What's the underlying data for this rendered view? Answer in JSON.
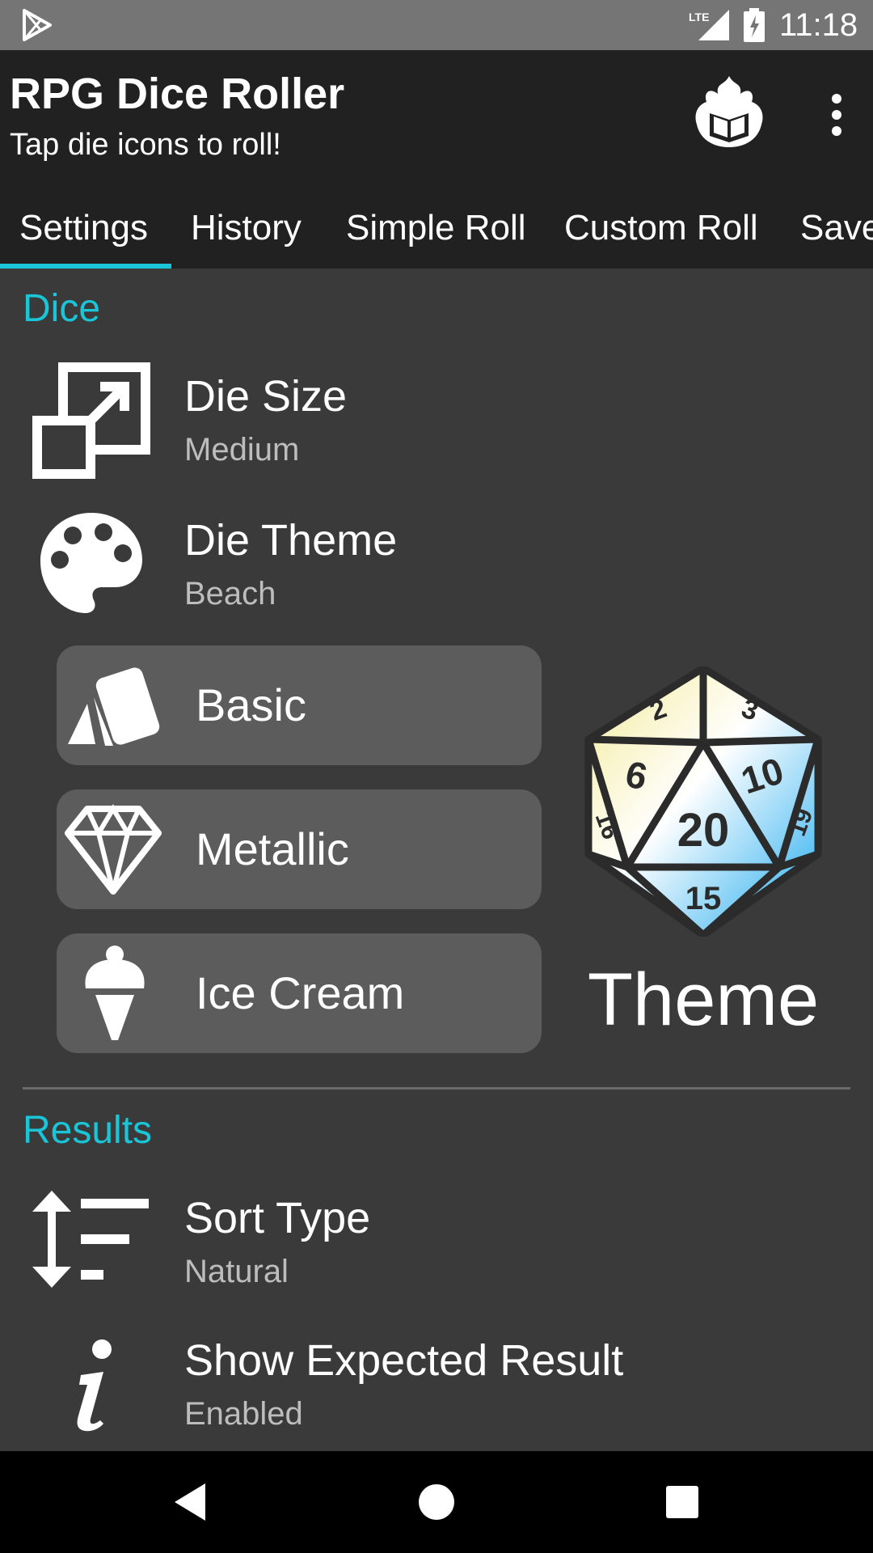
{
  "status_bar": {
    "time": "11:18",
    "network_label": "LTE",
    "icons": [
      "play-store-icon",
      "signal-icon",
      "battery-charging-icon"
    ]
  },
  "app_bar": {
    "title": "RPG Dice Roller",
    "subtitle": "Tap die icons to roll!",
    "icons": [
      "brand-flame-book-icon",
      "overflow-menu-icon"
    ]
  },
  "tabs": [
    {
      "label": "Settings",
      "selected": true
    },
    {
      "label": "History",
      "selected": false
    },
    {
      "label": "Simple Roll",
      "selected": false
    },
    {
      "label": "Custom Roll",
      "selected": false
    },
    {
      "label": "Save",
      "selected": false
    }
  ],
  "sections": {
    "dice": {
      "header": "Dice",
      "die_size": {
        "title": "Die Size",
        "summary": "Medium",
        "icon": "resize-icon"
      },
      "die_theme": {
        "title": "Die Theme",
        "summary": "Beach",
        "icon": "palette-icon"
      },
      "theme_buttons": [
        {
          "label": "Basic",
          "icon": "cards-icon"
        },
        {
          "label": "Metallic",
          "icon": "diamond-icon"
        },
        {
          "label": "Ice Cream",
          "icon": "ice-cream-icon"
        }
      ],
      "theme_preview": {
        "label": "Theme",
        "die_numbers": [
          "2",
          "3",
          "6",
          "10",
          "16",
          "20",
          "19",
          "15"
        ]
      }
    },
    "results": {
      "header": "Results",
      "sort_type": {
        "title": "Sort Type",
        "summary": "Natural",
        "icon": "sort-icon"
      },
      "show_expected": {
        "title": "Show Expected Result",
        "summary": "Enabled",
        "icon": "info-icon"
      }
    }
  },
  "nav_bar": {
    "buttons": [
      "back-icon",
      "home-icon",
      "recents-icon"
    ]
  },
  "colors": {
    "accent": "#19c5d6",
    "app_bar": "#212121",
    "status_bar": "#757575",
    "background": "#3a3a3a",
    "button": "#5c5c5c",
    "summary_text": "#bdbdbd"
  }
}
